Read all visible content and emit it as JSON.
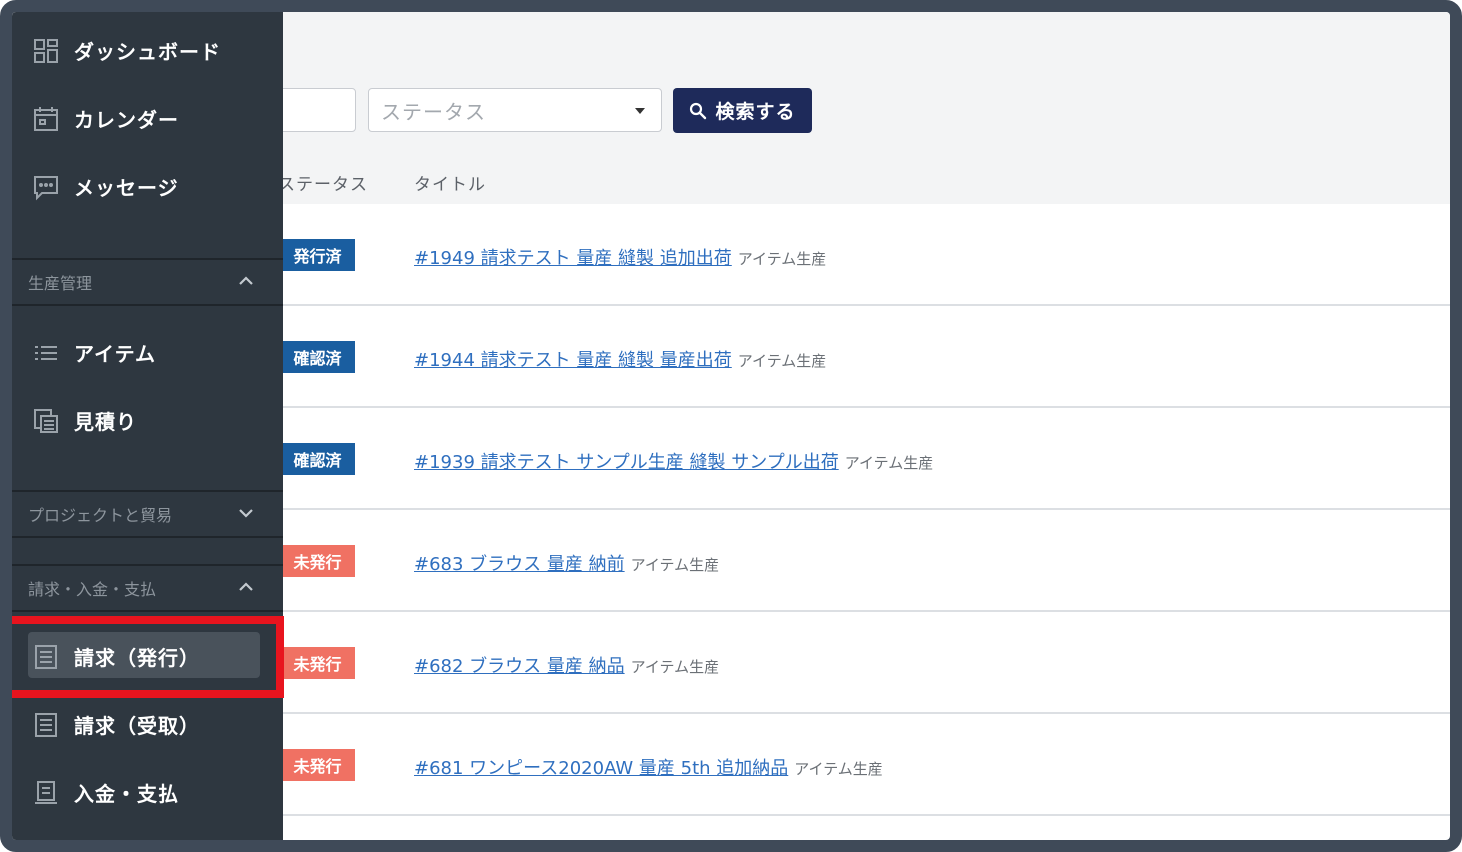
{
  "sidebar": {
    "top_items": [
      {
        "label": "ダッシュボード",
        "icon": "dashboard-icon"
      },
      {
        "label": "カレンダー",
        "icon": "calendar-icon"
      },
      {
        "label": "メッセージ",
        "icon": "message-icon"
      }
    ],
    "sections": [
      {
        "label": "生産管理",
        "state": "expanded"
      },
      {
        "label": "プロジェクトと貿易",
        "state": "collapsed"
      },
      {
        "label": "請求・入金・支払",
        "state": "expanded"
      }
    ],
    "production_items": [
      {
        "label": "アイテム",
        "icon": "list-icon"
      },
      {
        "label": "見積り",
        "icon": "estimate-icon"
      }
    ],
    "billing_items": [
      {
        "label": "請求（発行）",
        "icon": "document-icon",
        "active": true
      },
      {
        "label": "請求（受取）",
        "icon": "document-icon"
      },
      {
        "label": "入金・支払",
        "icon": "receipt-icon"
      }
    ]
  },
  "filters": {
    "status_placeholder": "ステータス",
    "search_label": "検索する"
  },
  "table": {
    "columns": [
      "ステータス",
      "タイトル"
    ],
    "rows": [
      {
        "status": "発行済",
        "title": "#1949 請求テスト 量産 縫製 追加出荷",
        "category": "アイテム生産"
      },
      {
        "status": "確認済",
        "title": "#1944 請求テスト 量産 縫製 量産出荷",
        "category": "アイテム生産"
      },
      {
        "status": "確認済",
        "title": "#1939 請求テスト サンプル生産 縫製 サンプル出荷",
        "category": "アイテム生産"
      },
      {
        "status": "未発行",
        "title": "#683 ブラウス 量産 納前",
        "category": "アイテム生産"
      },
      {
        "status": "未発行",
        "title": "#682 ブラウス 量産 納品",
        "category": "アイテム生産"
      },
      {
        "status": "未発行",
        "title": "#681 ワンピース2020AW 量産 5th 追加納品",
        "category": "アイテム生産"
      }
    ]
  },
  "colors": {
    "sidebar_bg": "#2e3740",
    "primary_button": "#1e2a5a",
    "badge_blue": "#1a5ea0",
    "badge_red": "#f07163",
    "highlight": "#e8141e",
    "link": "#2f6fbf"
  }
}
